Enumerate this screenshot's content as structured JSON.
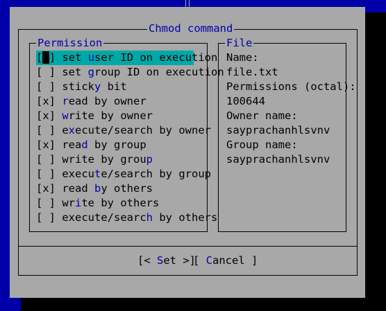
{
  "dialog": {
    "title": "Chmod command",
    "permission_title": "Permission",
    "file_title": "File"
  },
  "permissions": [
    {
      "mark": "[ ]",
      "pre": " set ",
      "hot": "u",
      "post": "ser ID on execution",
      "checked": false,
      "selected": true
    },
    {
      "mark": "[ ]",
      "pre": " set ",
      "hot": "g",
      "post": "roup ID on execution",
      "checked": false,
      "selected": false
    },
    {
      "mark": "[ ]",
      "pre": " stick",
      "hot": "y",
      "post": " bit",
      "checked": false,
      "selected": false
    },
    {
      "mark": "[x]",
      "pre": " ",
      "hot": "r",
      "post": "ead by owner",
      "checked": true,
      "selected": false
    },
    {
      "mark": "[x]",
      "pre": " ",
      "hot": "w",
      "post": "rite by owner",
      "checked": true,
      "selected": false
    },
    {
      "mark": "[ ]",
      "pre": " e",
      "hot": "x",
      "post": "ecute/search by owner",
      "checked": false,
      "selected": false
    },
    {
      "mark": "[x]",
      "pre": " rea",
      "hot": "d",
      "post": " by group",
      "checked": true,
      "selected": false
    },
    {
      "mark": "[ ]",
      "pre": " write by grou",
      "hot": "p",
      "post": "",
      "checked": false,
      "selected": false
    },
    {
      "mark": "[ ]",
      "pre": " execu",
      "hot": "t",
      "post": "e/search by group",
      "checked": false,
      "selected": false
    },
    {
      "mark": "[x]",
      "pre": " read ",
      "hot": "b",
      "post": "y others",
      "checked": true,
      "selected": false
    },
    {
      "mark": "[ ]",
      "pre": " wr",
      "hot": "i",
      "post": "te by others",
      "checked": false,
      "selected": false
    },
    {
      "mark": "[ ]",
      "pre": " execute/searc",
      "hot": "h",
      "post": " by others",
      "checked": false,
      "selected": false
    }
  ],
  "file_info": {
    "name_label": "Name:",
    "name_value": "file.txt",
    "perm_label": "Permissions (octal):",
    "perm_value": "100644",
    "owner_label": "Owner name:",
    "owner_value": "sayprachanhlsvnv",
    "group_label": "Group name:",
    "group_value": "sayprachanhlsvnv"
  },
  "buttons": {
    "set": {
      "pre": "[< ",
      "hot": "S",
      "post": "et >]"
    },
    "cancel": {
      "pre": "[ ",
      "hot": "C",
      "post": "ancel ]"
    }
  },
  "colors": {
    "background": "#0000a8",
    "dialog": "#a8a8a8",
    "selection": "#00a8a8",
    "hotkey": "#0000a8"
  }
}
